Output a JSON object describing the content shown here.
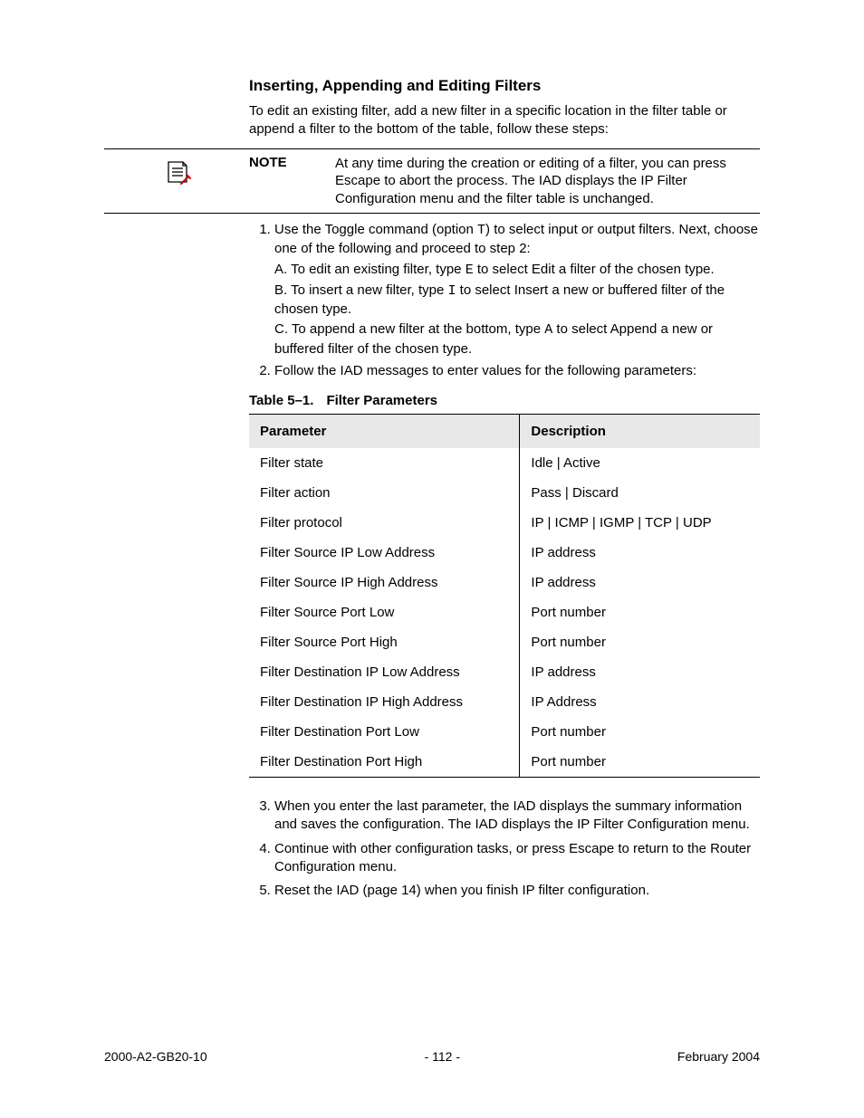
{
  "section_title": "Inserting, Appending and Editing Filters",
  "intro": "To edit an existing filter, add a new filter in a specific location in the filter table or append a filter to the bottom of the table, follow these steps:",
  "note": {
    "label": "NOTE",
    "body": "At any time during the creation or editing of a filter, you can press Escape to abort the process. The IAD displays the IP Filter Configuration menu and the filter table is unchanged."
  },
  "steps_first": {
    "s1_line1a": "Use the Toggle command (option ",
    "s1_code1": "T",
    "s1_line1b": ") to select input or output filters. Next, choose one of the following and proceed to step 2:",
    "s1_a_a": "A. To edit an existing filter, type ",
    "s1_a_code": "E",
    "s1_a_b": " to select Edit a filter of the chosen type.",
    "s1_b_a": "B. To insert a new filter, type ",
    "s1_b_code": "I",
    "s1_b_b": " to select Insert a new or buffered filter of the chosen type.",
    "s1_c_a": "C. To append a new filter at the bottom, type ",
    "s1_c_code": "A",
    "s1_c_b": " to select Append a new or buffered filter of the chosen type.",
    "s2": "Follow the IAD messages to enter values for the following parameters:"
  },
  "table": {
    "caption_num": "Table 5–1.",
    "caption_title": "Filter Parameters",
    "head_param": "Parameter",
    "head_desc": "Description",
    "rows": [
      {
        "p": "Filter state",
        "d": "Idle | Active"
      },
      {
        "p": "Filter action",
        "d": "Pass | Discard"
      },
      {
        "p": "Filter protocol",
        "d": "IP | ICMP | IGMP | TCP | UDP"
      },
      {
        "p": "Filter Source IP Low Address",
        "d": "IP address"
      },
      {
        "p": "Filter Source IP High Address",
        "d": "IP address"
      },
      {
        "p": "Filter Source Port Low",
        "d": "Port number"
      },
      {
        "p": "Filter Source Port High",
        "d": "Port number"
      },
      {
        "p": "Filter Destination IP Low Address",
        "d": "IP address"
      },
      {
        "p": "Filter Destination IP High Address",
        "d": "IP Address"
      },
      {
        "p": "Filter Destination Port Low",
        "d": "Port number"
      },
      {
        "p": "Filter Destination Port High",
        "d": "Port number"
      }
    ]
  },
  "steps_second": {
    "s3": "When you enter the last parameter, the IAD displays the summary information and saves the configuration. The IAD displays the IP Filter Configuration menu.",
    "s4": "Continue with other configuration tasks, or press Escape to return to the Router Configuration menu.",
    "s5": "Reset the IAD (page 14) when you finish IP filter configuration."
  },
  "footer": {
    "left": "2000-A2-GB20-10",
    "center": "- 112 -",
    "right": "February 2004"
  }
}
